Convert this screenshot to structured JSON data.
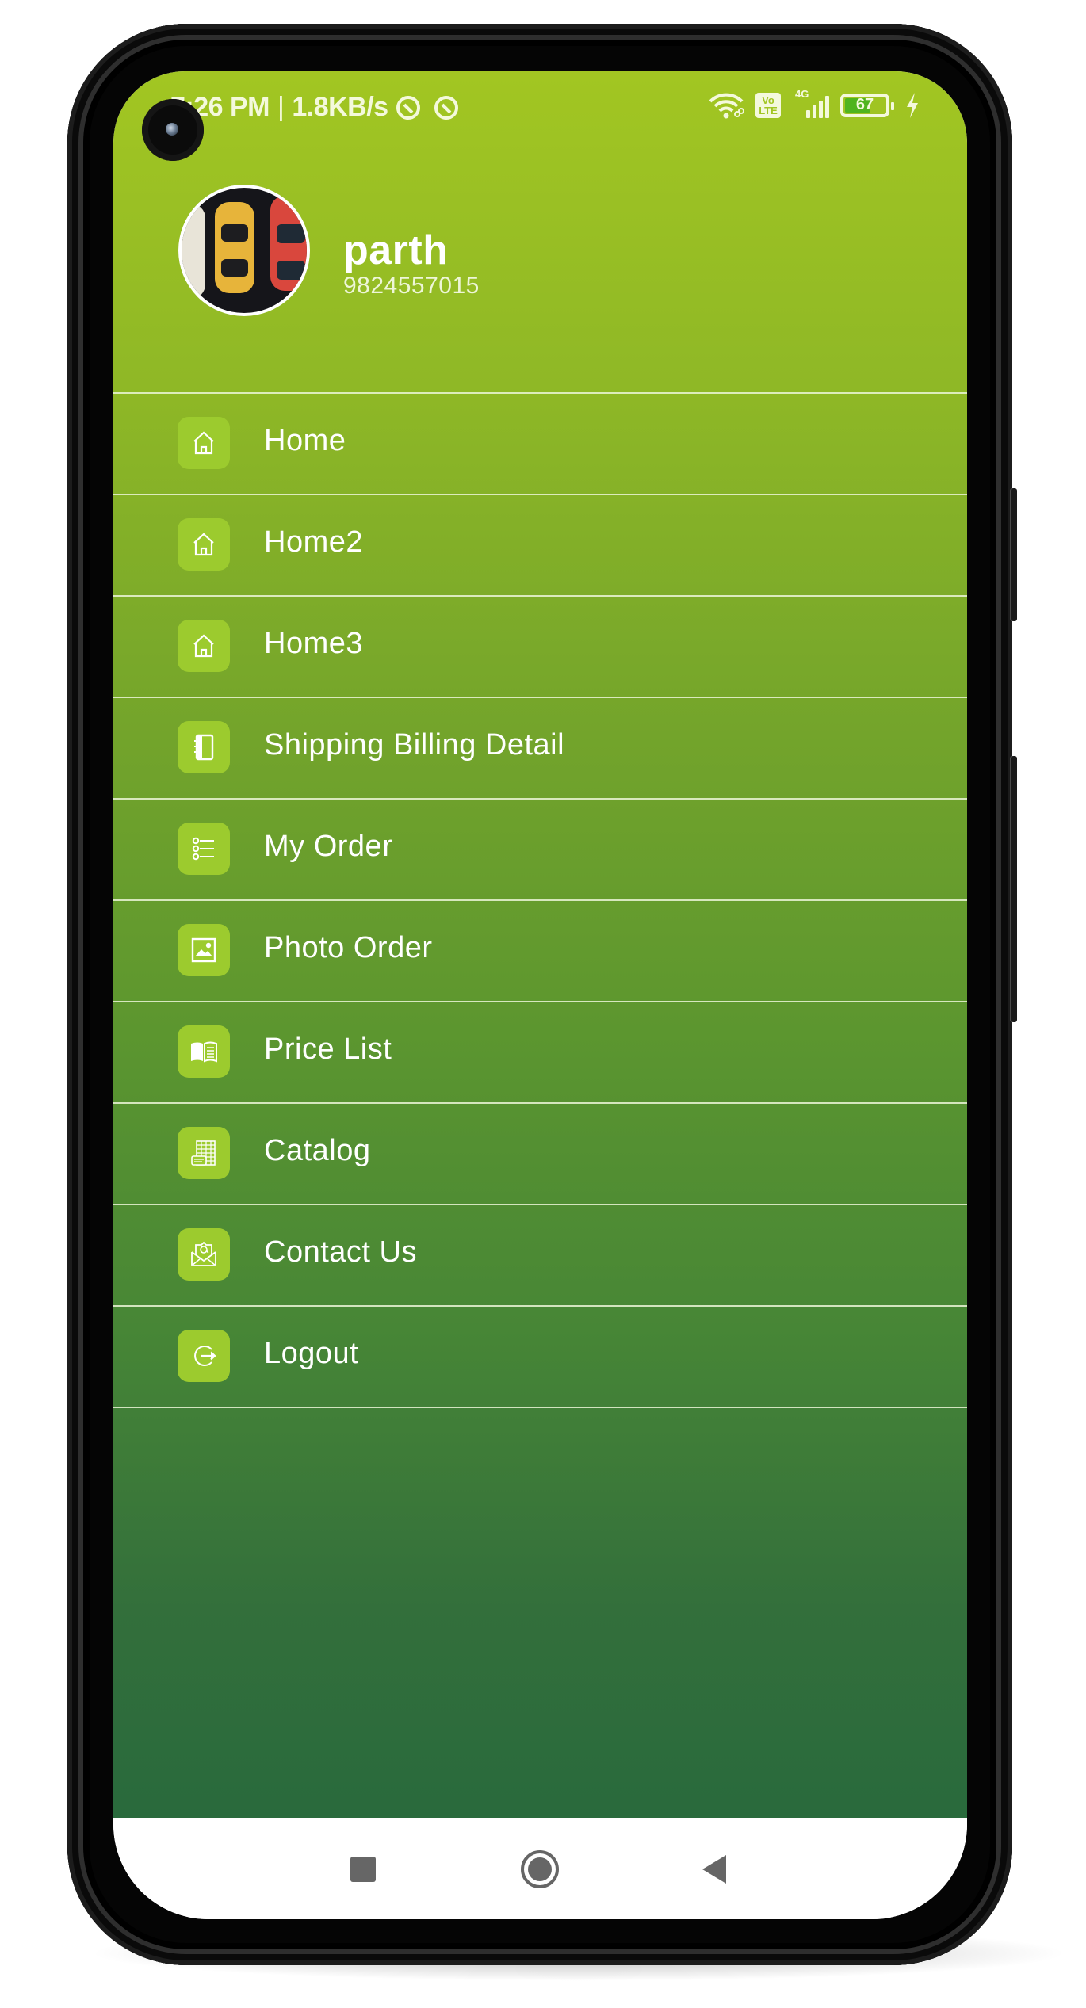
{
  "status_bar": {
    "time": "7:26 PM",
    "separator": "|",
    "network_speed": "1.8KB/s",
    "left_icons": [
      "sync-ring-icon",
      "sync-ring-icon"
    ],
    "right_icons": [
      "wifi-icon",
      "volte-icon",
      "signal-4g-icon",
      "battery-icon",
      "charging-bolt-icon"
    ],
    "volte_line1": "Vo",
    "volte_line2": "LTE",
    "network_type": "4G",
    "battery_percent": 67,
    "battery_label": "67"
  },
  "profile": {
    "name": "parth",
    "phone": "9824557015",
    "avatar_description": "toy cars photo"
  },
  "menu": {
    "items": [
      {
        "label": "Home",
        "icon": "home-icon"
      },
      {
        "label": "Home2",
        "icon": "home-icon"
      },
      {
        "label": "Home3",
        "icon": "home-icon"
      },
      {
        "label": "Shipping Billing Detail",
        "icon": "address-book-icon"
      },
      {
        "label": "My Order",
        "icon": "list-icon"
      },
      {
        "label": "Photo Order",
        "icon": "image-icon"
      },
      {
        "label": "Price List",
        "icon": "open-book-icon"
      },
      {
        "label": "Catalog",
        "icon": "catalog-grid-icon"
      },
      {
        "label": "Contact Us",
        "icon": "email-at-icon"
      },
      {
        "label": "Logout",
        "icon": "logout-icon"
      }
    ]
  },
  "navbar": {
    "buttons": [
      "recent-apps",
      "home",
      "back"
    ]
  },
  "colors": {
    "gradient_top": "#a2c622",
    "gradient_mid": "#5f9a30",
    "gradient_bottom": "#296a3c",
    "icon_box": "#9ccb2e",
    "text": "#ffffff",
    "nav_icon": "#666666"
  }
}
